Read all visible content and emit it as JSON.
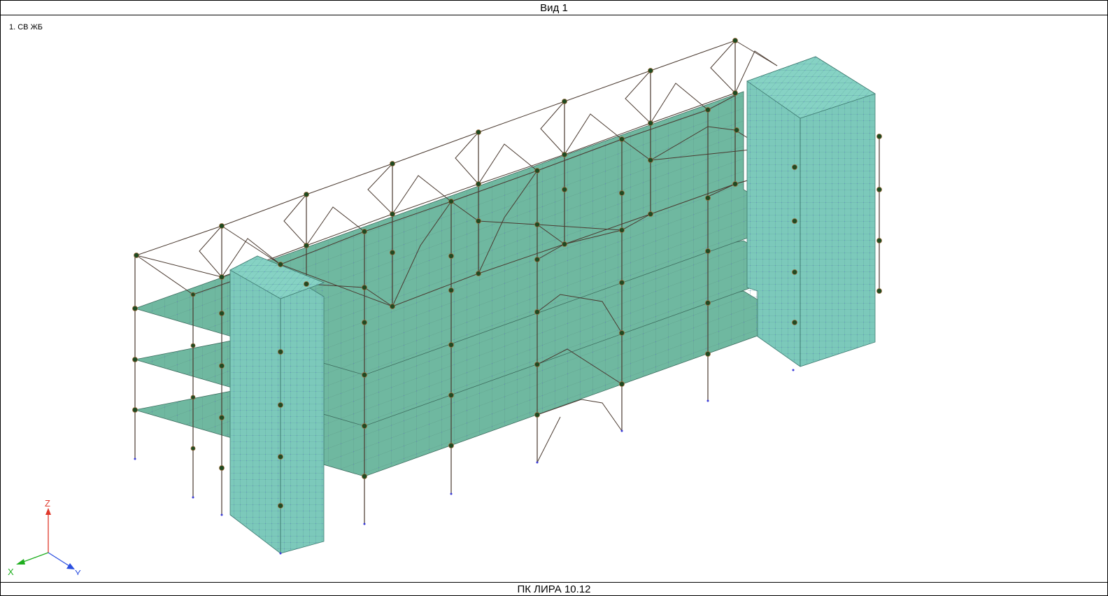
{
  "window": {
    "title": "Вид 1"
  },
  "viewport": {
    "load_case_label": "1. СВ ЖБ"
  },
  "axes": {
    "x_label": "X",
    "y_label": "Y",
    "z_label": "Z"
  },
  "footer": {
    "program_label": "ПК ЛИРА 10.12"
  },
  "colors": {
    "slab": "#6fb8a0",
    "core": "#7cc9bb",
    "frame_line": "#4a3a30",
    "node": "#1f4a22",
    "mesh_dot": "#5a5adc",
    "axis_x": "#1fae1f",
    "axis_y": "#2b4fe0",
    "axis_z": "#e0382b"
  }
}
